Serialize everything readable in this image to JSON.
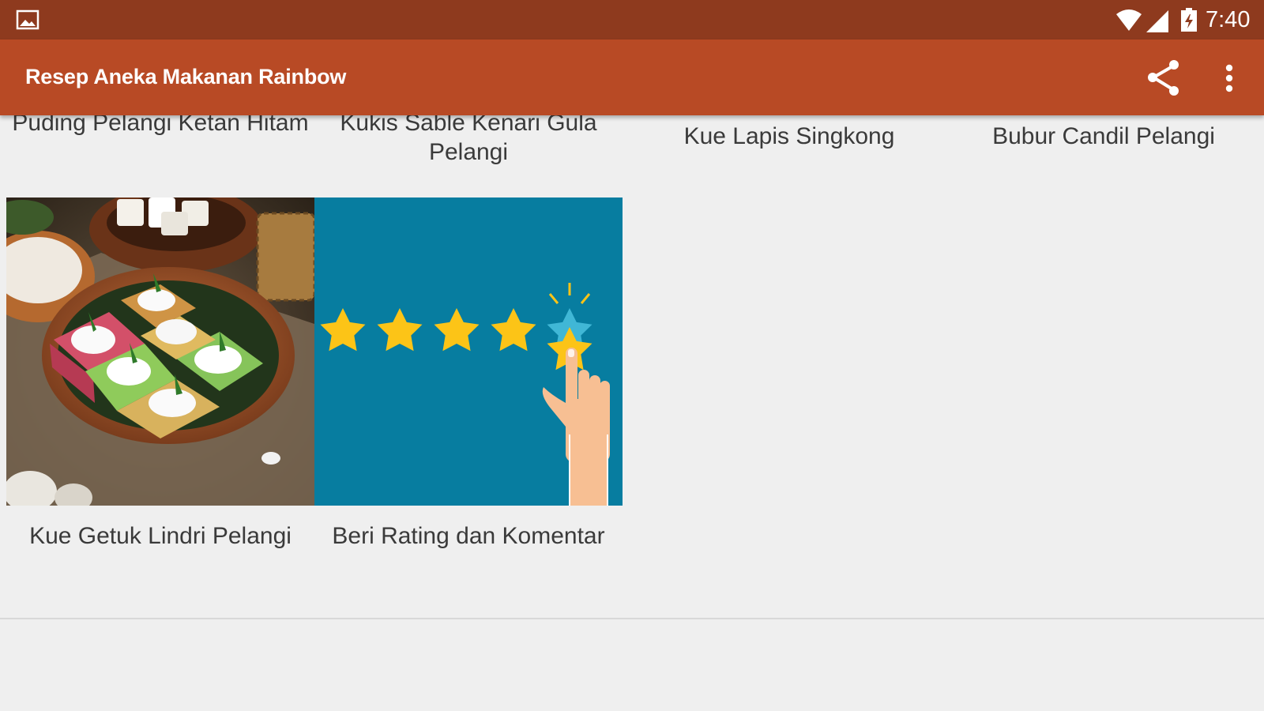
{
  "status_bar": {
    "time": "7:40",
    "icons": [
      "gallery-icon",
      "wifi-icon",
      "signal-icon",
      "battery-icon"
    ]
  },
  "action_bar": {
    "title": "Resep Aneka Makanan Rainbow",
    "actions": [
      "share-icon",
      "more-vert-icon"
    ]
  },
  "grid": {
    "top_row": [
      {
        "label": "Puding Pelangi Ketan Hitam"
      },
      {
        "label": "Kukis Sable Kenari Gula Pelangi"
      },
      {
        "label": "Kue Lapis Singkong"
      },
      {
        "label": "Bubur Candil Pelangi"
      }
    ],
    "bottom_row": [
      {
        "label": "Kue Getuk Lindri Pelangi",
        "image": "getuk-lindri-photo"
      },
      {
        "label": "Beri Rating dan Komentar",
        "image": "rating-stars-illustration"
      }
    ]
  },
  "colors": {
    "status_bar": "#8e3a1e",
    "action_bar": "#b84a25",
    "background": "#efefef",
    "rating_bg": "#077da0",
    "star": "#fcc417"
  }
}
